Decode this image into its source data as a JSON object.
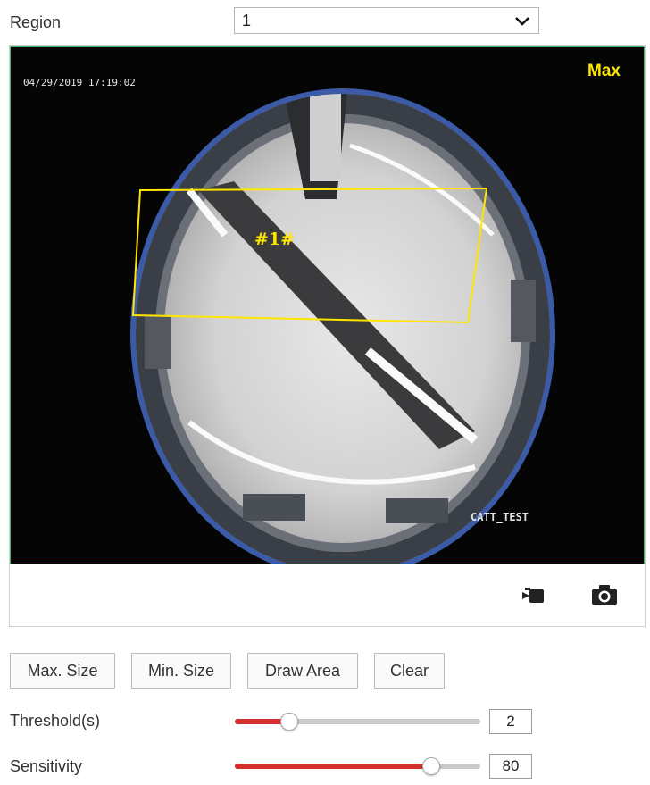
{
  "region": {
    "label": "Region",
    "selected": "1"
  },
  "video": {
    "timestamp": "04/29/2019 17:19:02",
    "zoom_badge": "Max",
    "region_tag": "#1#",
    "camera_name": "CATT_TEST"
  },
  "toolbar": {
    "record_icon": "video-record-icon",
    "capture_icon": "camera-snapshot-icon"
  },
  "buttons": {
    "max_size": "Max. Size",
    "min_size": "Min. Size",
    "draw_area": "Draw Area",
    "clear": "Clear"
  },
  "threshold": {
    "label": "Threshold(s)",
    "value": "2",
    "fraction": 0.22
  },
  "sensitivity": {
    "label": "Sensitivity",
    "value": "80",
    "fraction": 0.8
  },
  "colors": {
    "accent": "#d32f2f",
    "region_box": "#ffe600",
    "video_border": "#45b96b"
  }
}
